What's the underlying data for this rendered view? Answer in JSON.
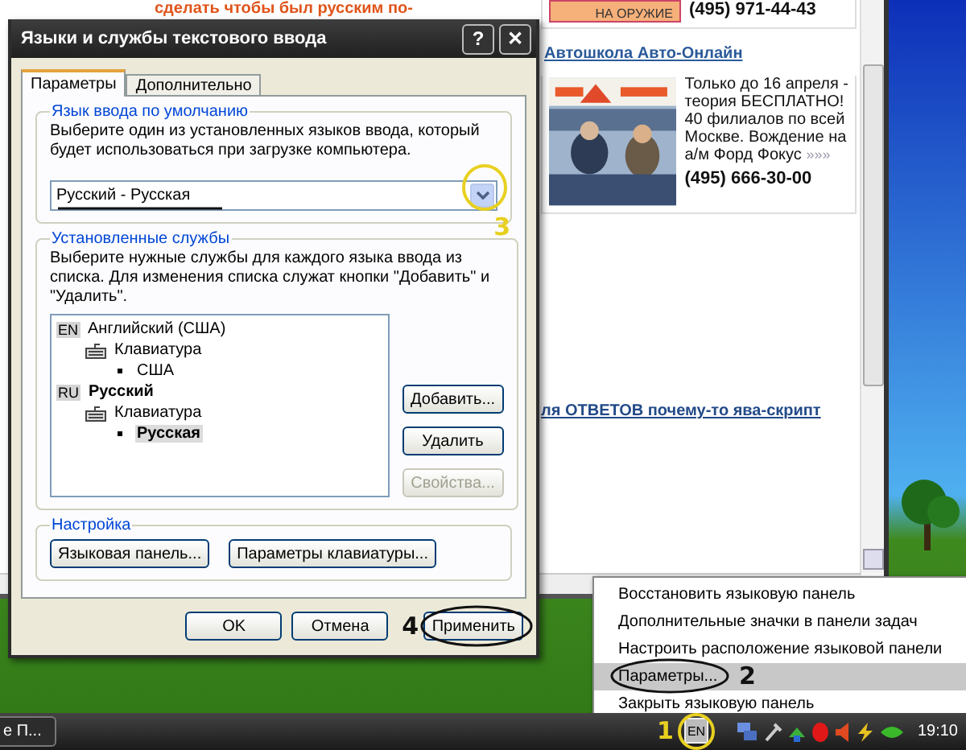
{
  "browser": {
    "headline": "сделать чтобы был русским по-",
    "ads": [
      {
        "banner": "НА ОРУЖИЕ",
        "phone": "(495) 971-44-43"
      },
      {
        "title": "Автошкола Авто-Онлайн",
        "lines": [
          "Только до 16 апреля -",
          "теория БЕСПЛАТНО!",
          "40 филиалов по всей",
          "Москве. Вождение на",
          "а/м Форд Фокус"
        ],
        "more": "»»»",
        "phone": "(495) 666-30-00"
      }
    ],
    "link": "ля ОТВЕТОВ почему-то ява-скрипт"
  },
  "dialog": {
    "title": "Языки и службы текстового ввода",
    "help": "?",
    "close": "✕",
    "tabs": [
      {
        "label": "Параметры",
        "selected": true
      },
      {
        "label": "Дополнительно",
        "selected": false
      }
    ],
    "default_language": {
      "legend": "Язык ввода по умолчанию",
      "description": "Выберите один из установленных языков ввода, который будет использоваться при загрузке компьютера.",
      "value": "Русский - Русская"
    },
    "services": {
      "legend": "Установленные службы",
      "description": "Выберите нужные службы для каждого языка ввода из списка. Для изменения списка служат кнопки \"Добавить\" и \"Удалить\".",
      "tree": [
        {
          "kind": "language",
          "code": "EN",
          "label": "Английский (США)",
          "emphasized": false,
          "selected": false,
          "children": [
            {
              "kind": "device",
              "label": "Клавиатура",
              "emphasized": false,
              "selected": false,
              "children": [
                {
                  "kind": "layout",
                  "label": "США",
                  "emphasized": false,
                  "selected": false
                }
              ]
            }
          ]
        },
        {
          "kind": "language",
          "code": "RU",
          "label": "Русский",
          "emphasized": true,
          "selected": false,
          "children": [
            {
              "kind": "device",
              "label": "Клавиатура",
              "emphasized": false,
              "selected": false,
              "children": [
                {
                  "kind": "layout",
                  "label": "Русская",
                  "emphasized": true,
                  "selected": true
                }
              ]
            }
          ]
        }
      ],
      "buttons": [
        {
          "label": "Добавить...",
          "disabled": false
        },
        {
          "label": "Удалить",
          "disabled": false
        },
        {
          "label": "Свойства...",
          "disabled": true
        }
      ]
    },
    "settings": {
      "legend": "Настройка",
      "buttons": [
        "Языковая панель...",
        "Параметры клавиатуры..."
      ]
    },
    "buttons": [
      "OK",
      "Отмена",
      "Применить"
    ]
  },
  "context_menu": [
    {
      "label": "Восстановить языковую панель",
      "selected": false
    },
    {
      "label": "Дополнительные значки в панели задач",
      "selected": false
    },
    {
      "label": "Настроить расположение языковой панели",
      "selected": false
    },
    {
      "label": "Параметры...",
      "selected": true
    },
    {
      "label": "Закрыть языковую панель",
      "selected": false
    }
  ],
  "taskbar": {
    "button": "е П...",
    "language": "EN",
    "time": "19:10"
  },
  "annotations": [
    {
      "label": "3",
      "color": "#e8d020"
    },
    {
      "label": "4",
      "color": "#111111"
    },
    {
      "label": "2",
      "color": "#111111"
    },
    {
      "label": "1",
      "color": "#e8d020"
    }
  ]
}
